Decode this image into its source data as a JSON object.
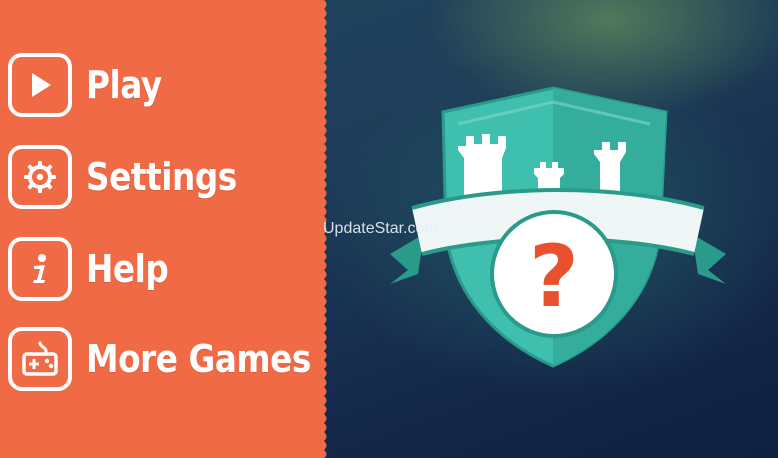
{
  "menu": {
    "items": [
      {
        "label": "Play",
        "icon": "play-icon"
      },
      {
        "label": "Settings",
        "icon": "gear-icon"
      },
      {
        "label": "Help",
        "icon": "info-icon"
      },
      {
        "label": "More Games",
        "icon": "gamepad-icon"
      }
    ]
  },
  "watermark": "UpdateStar.com",
  "emblem": {
    "symbol": "?",
    "icon": "castle-shield-icon"
  },
  "colors": {
    "panel": "#f06a45",
    "teal": "#3fbfae",
    "teal_dark": "#2a9b8a",
    "question": "#e8502e",
    "white": "#ffffff"
  }
}
